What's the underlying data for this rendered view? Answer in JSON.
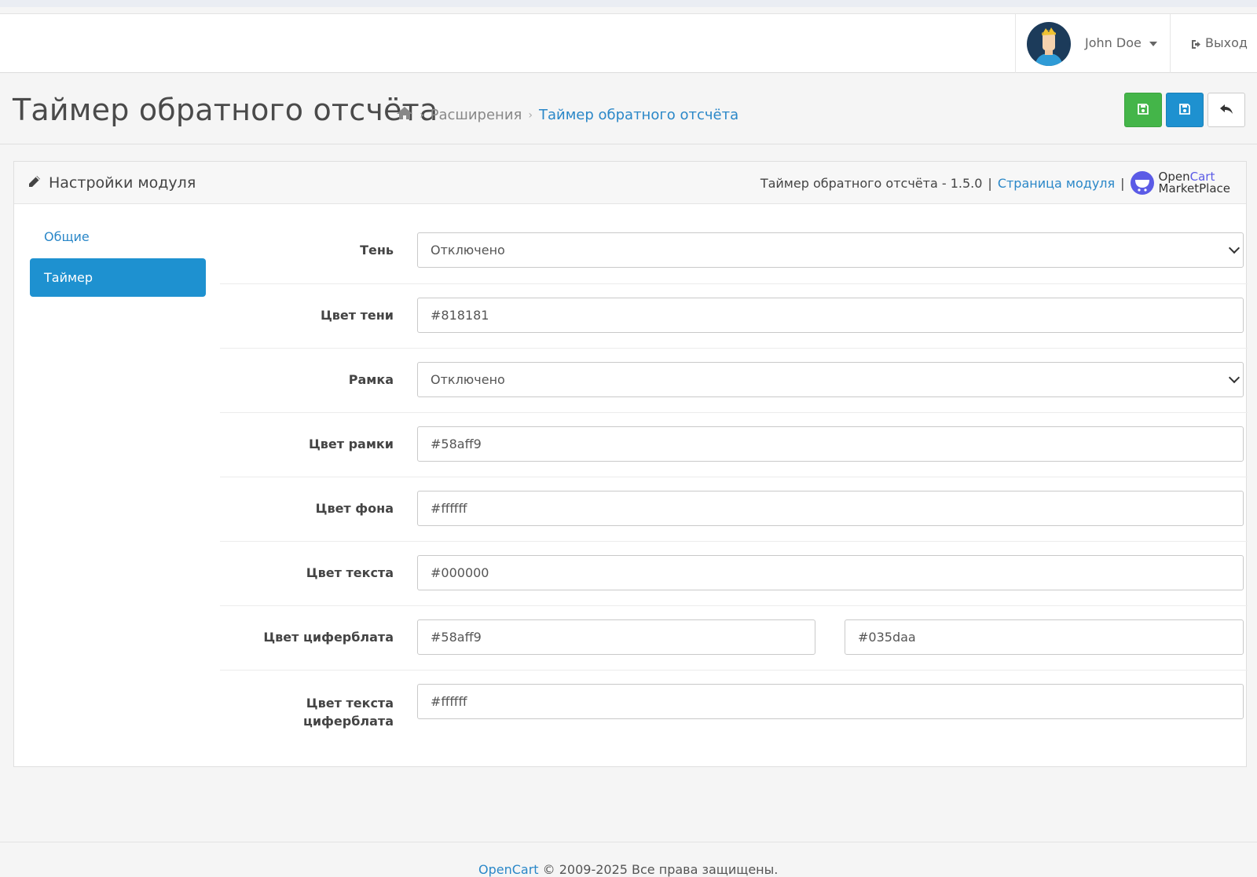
{
  "header": {
    "user_name": "John Doe",
    "logout_label": "Выход"
  },
  "page": {
    "title": "Таймер обратного отсчёта",
    "breadcrumb": [
      {
        "label": "Расширения"
      },
      {
        "label": "Таймер обратного отсчёта"
      }
    ]
  },
  "panel": {
    "title": "Настройки модуля",
    "version_text": "Таймер обратного отсчёта - 1.5.0",
    "separator": "|",
    "module_page_link": "Страница модуля",
    "marketplace": {
      "open": "Open",
      "cart": "Cart",
      "marketplace": "MarketPlace"
    }
  },
  "tabs": {
    "general": "Общие",
    "timer": "Таймер"
  },
  "form": {
    "shadow": {
      "label": "Тень",
      "value": "Отключено"
    },
    "shadow_color": {
      "label": "Цвет тени",
      "value": "#818181"
    },
    "border": {
      "label": "Рамка",
      "value": "Отключено"
    },
    "border_color": {
      "label": "Цвет рамки",
      "value": "#58aff9"
    },
    "background_color": {
      "label": "Цвет фона",
      "value": "#ffffff"
    },
    "text_color": {
      "label": "Цвет текста",
      "value": "#000000"
    },
    "dial_color": {
      "label": "Цвет циферблата",
      "value1": "#58aff9",
      "value2": "#035daa"
    },
    "dial_text_color": {
      "label_line1": "Цвет текста",
      "label_line2": "циферблата",
      "value": "#ffffff"
    }
  },
  "footer": {
    "link": "OpenCart",
    "text": " © 2009-2025 Все права защищены."
  },
  "colors": {
    "primary": "#1e91d0",
    "success": "#44b549",
    "link": "#2a87c8",
    "marketplace": "#5b5be6"
  }
}
